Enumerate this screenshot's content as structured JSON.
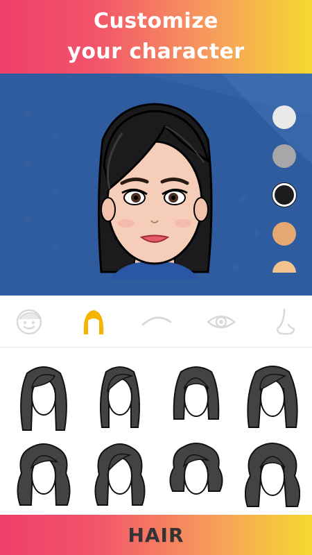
{
  "header": {
    "line1": "Customize",
    "line2": "your character"
  },
  "preview": {
    "background_color": "#2f5b9f",
    "hair_color_swatches": [
      {
        "name": "white",
        "color": "#e9e9ea",
        "selected": false
      },
      {
        "name": "gray",
        "color": "#a7a7aa",
        "selected": false
      },
      {
        "name": "black",
        "color": "#1c1c1f",
        "selected": true
      },
      {
        "name": "light-brown",
        "color": "#e6a873",
        "selected": false
      },
      {
        "name": "peach",
        "color": "#f2c28e",
        "selected": false
      }
    ]
  },
  "category_tabs": [
    {
      "name": "face",
      "icon": "face-icon",
      "active": false
    },
    {
      "name": "hair",
      "icon": "hair-icon",
      "active": true
    },
    {
      "name": "eyebrows",
      "icon": "eyebrow-icon",
      "active": false
    },
    {
      "name": "eyes",
      "icon": "eye-icon",
      "active": false
    },
    {
      "name": "nose",
      "icon": "nose-icon",
      "active": false
    }
  ],
  "hair_styles": [
    {
      "style": "long-straight",
      "icon": "hair-style-icon"
    },
    {
      "style": "medium-side-part",
      "icon": "hair-style-icon"
    },
    {
      "style": "shoulder-bob",
      "icon": "hair-style-icon"
    },
    {
      "style": "long-layered",
      "icon": "hair-style-icon"
    },
    {
      "style": "long-wavy",
      "icon": "hair-style-icon"
    },
    {
      "style": "long-wavy-part",
      "icon": "hair-style-icon"
    },
    {
      "style": "curly-bob",
      "icon": "hair-style-icon"
    },
    {
      "style": "long-curly",
      "icon": "hair-style-icon"
    }
  ],
  "colors": {
    "accent": "#f5b400",
    "tab_inactive": "#d9d9d9",
    "footer_text": "#333333"
  },
  "footer": {
    "label": "HAIR"
  }
}
